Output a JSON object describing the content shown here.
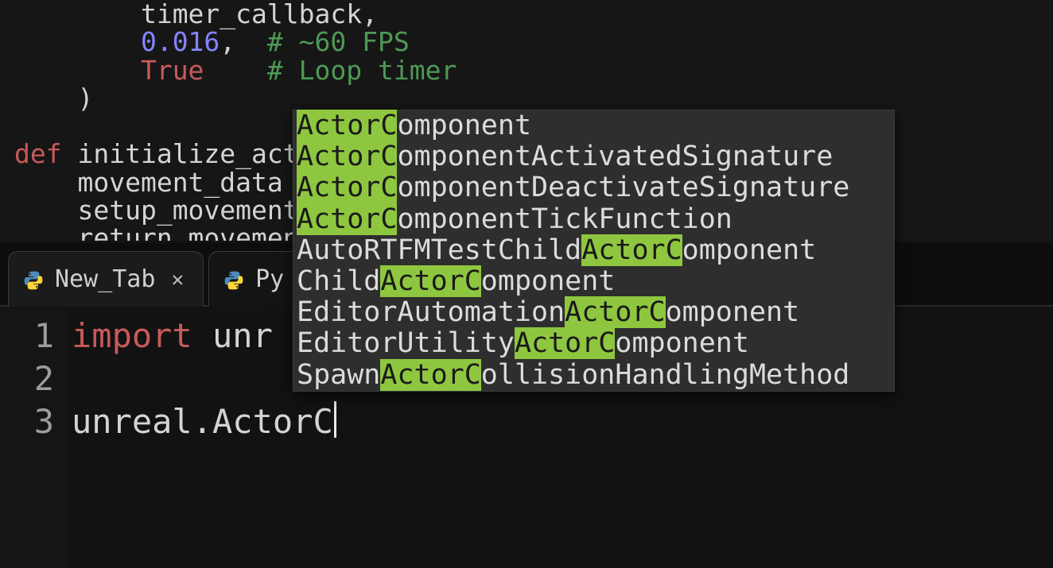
{
  "upper_code": {
    "l0_indent": "        ",
    "l0_a": "timer_callback",
    "l0_b": ",",
    "l1_indent": "        ",
    "l1_num": "0.016",
    "l1_comma": ", ",
    "l1_pad": " ",
    "l1_comment": "# ~60 FPS",
    "l2_indent": "        ",
    "l2_bool": "True",
    "l2_pad": "    ",
    "l2_comment": "# Loop timer",
    "l3_indent": "    ",
    "l3_paren": ")",
    "l4": " ",
    "l5_indent": "",
    "l5_def": "def ",
    "l5_name": "initialize_acto",
    "l6_indent": "    ",
    "l6": "movement_data =",
    "l7_indent": "    ",
    "l7": "setup_movement_",
    "l8_indent": "    ",
    "l8": "return movement"
  },
  "tabs": [
    {
      "label": "New_Tab",
      "closable": true
    },
    {
      "label": "Py",
      "closable": false
    }
  ],
  "lower_code": {
    "line1_import": "import",
    "line1_rest": " unr",
    "line2": " ",
    "line3_a": "unreal",
    "line3_dot": ".",
    "line3_b": "ActorC"
  },
  "gutter": [
    "1",
    "2",
    "3"
  ],
  "autocomplete": {
    "query": "ActorC",
    "items": [
      {
        "pre": "",
        "match": "ActorC",
        "post": "omponent"
      },
      {
        "pre": "",
        "match": "ActorC",
        "post": "omponentActivatedSignature"
      },
      {
        "pre": "",
        "match": "ActorC",
        "post": "omponentDeactivateSignature"
      },
      {
        "pre": "",
        "match": "ActorC",
        "post": "omponentTickFunction"
      },
      {
        "pre": "AutoRTFMTestChild",
        "match": "ActorC",
        "post": "omponent"
      },
      {
        "pre": "Child",
        "match": "ActorC",
        "post": "omponent"
      },
      {
        "pre": "EditorAutomation",
        "match": "ActorC",
        "post": "omponent"
      },
      {
        "pre": "EditorUtility",
        "match": "ActorC",
        "post": "omponent"
      },
      {
        "pre": "Spawn",
        "match": "ActorC",
        "post": "ollisionHandlingMethod"
      }
    ]
  }
}
